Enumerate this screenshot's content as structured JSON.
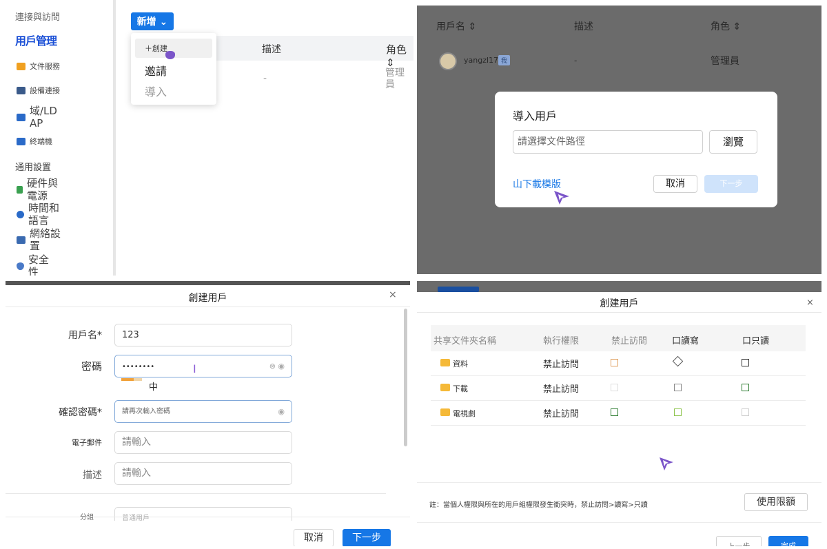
{
  "panel1": {
    "sidebar": {
      "header": "連接與訪問",
      "active_item": "用戶管理",
      "items": [
        {
          "label": "文件服務",
          "color": "#f0a020"
        },
        {
          "label": "設備連接",
          "color": "#3a5a8a"
        },
        {
          "label": "域/LD AP",
          "color": "#2a6ac8"
        },
        {
          "label": "終端機",
          "color": "#2a6ac8"
        }
      ],
      "section": "通用設置",
      "settings": [
        {
          "label": "硬件與電源",
          "color": "#3aa050"
        },
        {
          "label": "時間和語言",
          "color": "#2a6ac8"
        },
        {
          "label": "網絡設置",
          "color": "#3a6ab0"
        },
        {
          "label": "安全性",
          "color": "#4a7ac8"
        }
      ]
    },
    "new_button": "新增 ⌄",
    "table": {
      "headers": [
        "描述",
        "角色⇕"
      ],
      "row": {
        "desc": "-",
        "role": "管理員"
      }
    },
    "menu": {
      "items": [
        "＋創建",
        "邀請",
        "導入"
      ]
    }
  },
  "panel2": {
    "headers": [
      "用戶名 ⇕",
      "描述",
      "角色 ⇕"
    ],
    "row": {
      "username": "yangzl17",
      "badge": "我",
      "desc": "-",
      "role": "管理員"
    },
    "dialog": {
      "title": "導入用戶",
      "path_placeholder": "請選擇文件路徑",
      "browse": "瀏覽",
      "download_template": "山下載模版",
      "cancel": "取消",
      "next": "下一步"
    }
  },
  "panel3": {
    "title": "創建用戶",
    "close": "×",
    "fields": [
      {
        "label": "用戶名*",
        "value": "123"
      },
      {
        "label": "密碼",
        "value": "••••••••"
      },
      {
        "label": "確認密碼*",
        "placeholder": "請再次輸入密碼"
      },
      {
        "label": "電子郵件",
        "placeholder": "請輸入"
      },
      {
        "label": "描述",
        "placeholder": "請輸入"
      }
    ],
    "strength": {
      "label": "中",
      "level": 0.6
    },
    "cut_field": {
      "label": "分組",
      "value": "普通用戶"
    },
    "cancel": "取消",
    "next": "下一步"
  },
  "panel4": {
    "title": "創建用戶",
    "close": "×",
    "headers": [
      "共享文件夾名稱",
      "執行權限",
      "禁止訪問",
      "口讀寫",
      "口只讀"
    ],
    "rows": [
      {
        "name": "資料",
        "perm": "禁止訪問"
      },
      {
        "name": "下載",
        "perm": "禁止訪問"
      },
      {
        "name": "電視劇",
        "perm": "禁止訪問"
      }
    ],
    "note": "註：當個人權限與所在的用戶組權限發生衝突時，禁止訪問>讀寫>只讀",
    "quota": "使用限額",
    "prev": "上一步",
    "done": "完成"
  }
}
